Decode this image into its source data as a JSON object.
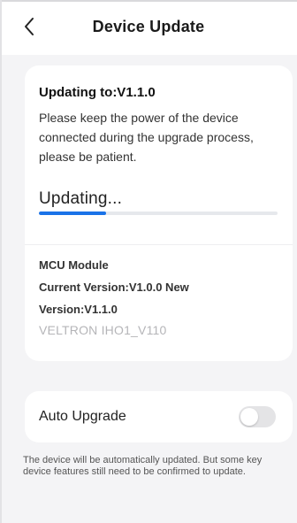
{
  "header": {
    "title": "Device Update",
    "back_glyph": "<"
  },
  "update": {
    "heading": "Updating to:V1.1.0",
    "description": "Please keep the power of the device connected during the upgrade process, please be patient.",
    "status_label": "Updating...",
    "progress_fraction": 0.28,
    "accent_color": "#1a73e8"
  },
  "module": {
    "name": "MCU Module",
    "current_version": "Current Version:V1.0.0 New",
    "new_version": "Version:V1.1.0",
    "firmware": "VELTRON IHO1_V110"
  },
  "auto_upgrade": {
    "label": "Auto Upgrade",
    "enabled": false,
    "note": "The device will be automatically updated. But some key device features still need to be confirmed to update."
  },
  "icons": {
    "back": "chevron-left-icon"
  }
}
